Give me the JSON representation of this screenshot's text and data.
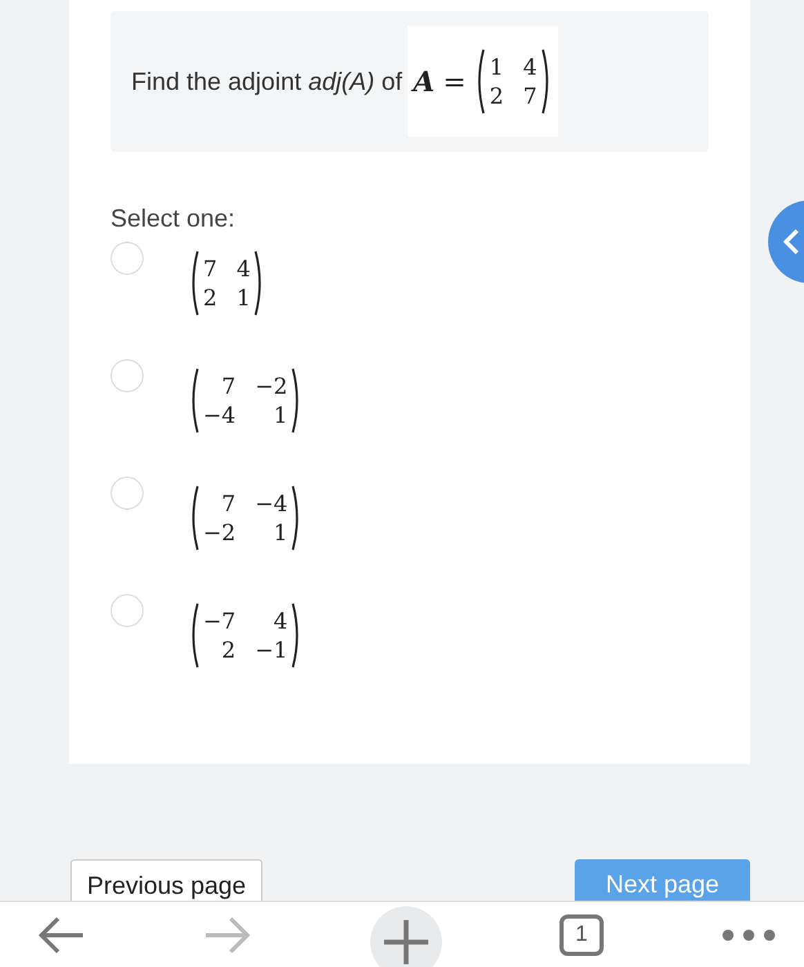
{
  "question": {
    "text": "Find the adjoint *adj(A)* of",
    "matrix_name": "A",
    "equals": "=",
    "matrix": [
      [
        "1",
        "4"
      ],
      [
        "2",
        "7"
      ]
    ]
  },
  "prompt": "Select one:",
  "options": [
    {
      "selected": false,
      "matrix": [
        [
          "7",
          "4"
        ],
        [
          "2",
          "1"
        ]
      ]
    },
    {
      "selected": false,
      "matrix": [
        [
          "7",
          "−2"
        ],
        [
          "−4",
          "1"
        ]
      ]
    },
    {
      "selected": false,
      "matrix": [
        [
          "7",
          "−4"
        ],
        [
          "−2",
          "1"
        ]
      ]
    },
    {
      "selected": false,
      "matrix": [
        [
          "−7",
          "4"
        ],
        [
          "2",
          "−1"
        ]
      ]
    }
  ],
  "navigation": {
    "previous": "Previous page",
    "next": "Next page"
  },
  "browser_bar": {
    "tab_count": "1"
  }
}
